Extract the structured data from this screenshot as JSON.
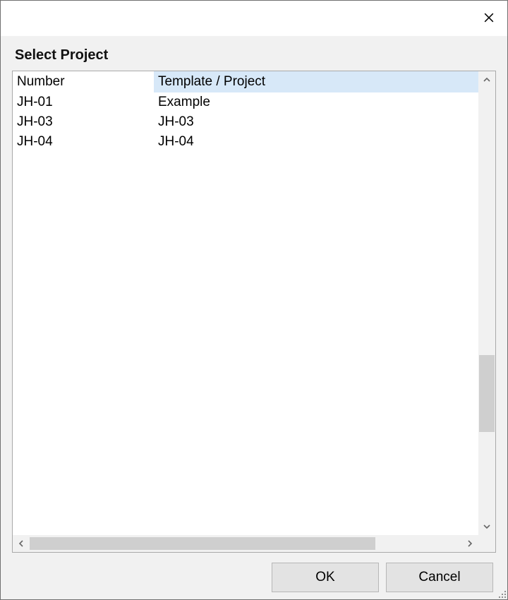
{
  "dialog": {
    "title": "Select Project",
    "columns": {
      "number": "Number",
      "template": "Template / Project"
    },
    "rows": [
      {
        "number": "JH-01",
        "template": "Example"
      },
      {
        "number": "JH-03",
        "template": "JH-03"
      },
      {
        "number": "JH-04",
        "template": "JH-04"
      }
    ],
    "buttons": {
      "ok": "OK",
      "cancel": "Cancel"
    }
  }
}
